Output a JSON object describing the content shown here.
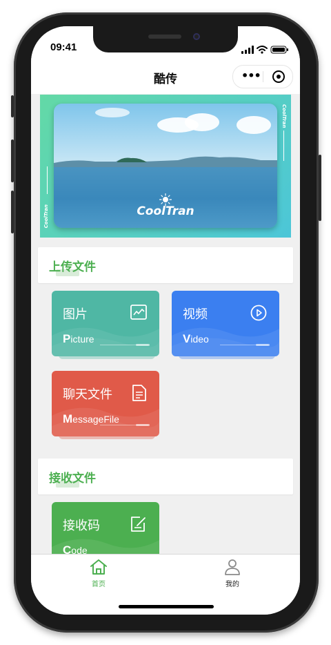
{
  "status": {
    "time": "09:41"
  },
  "nav": {
    "title": "酷传"
  },
  "banner": {
    "brand": "CoolTran",
    "side_right": "CoolTran",
    "side_left": "CoolTran"
  },
  "upload_section": {
    "title": "上传文件",
    "cards": [
      {
        "title": "图片",
        "sub_initial": "P",
        "sub_rest": "icture",
        "icon": "image-icon",
        "color": "#4fb7a4"
      },
      {
        "title": "视频",
        "sub_initial": "V",
        "sub_rest": "ideo",
        "icon": "play-icon",
        "color": "#3b7ff0"
      },
      {
        "title": "聊天文件",
        "sub_initial": "M",
        "sub_rest": "essageFile",
        "icon": "document-icon",
        "color": "#e05a49"
      }
    ]
  },
  "receive_section": {
    "title": "接收文件",
    "cards": [
      {
        "title": "接收码",
        "sub_initial": "C",
        "sub_rest": "ode",
        "icon": "edit-icon",
        "color": "#4caf50"
      }
    ]
  },
  "tabbar": {
    "items": [
      {
        "label": "首页",
        "icon": "home-icon",
        "active": true
      },
      {
        "label": "我的",
        "icon": "user-icon",
        "active": false
      }
    ],
    "active_color": "#4caf50"
  }
}
